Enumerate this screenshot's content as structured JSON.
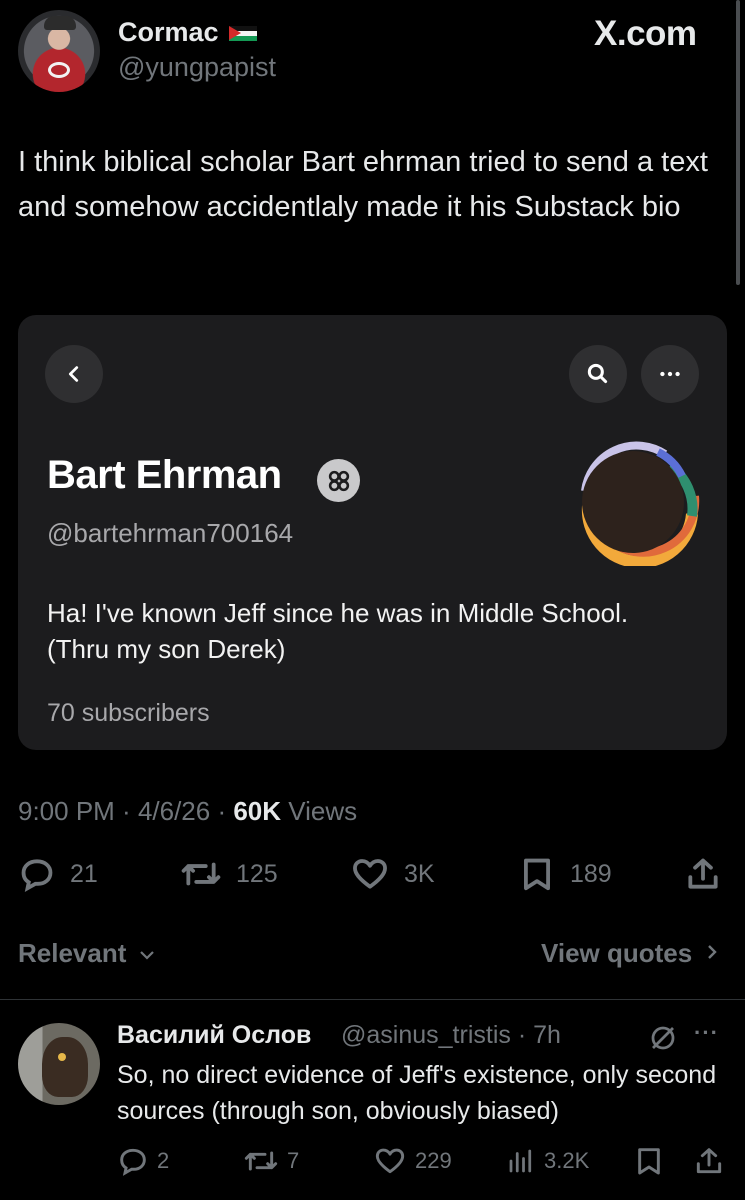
{
  "header": {
    "author_name": "Cormac",
    "author_handle": "@yungpapist",
    "site_label": "X.com"
  },
  "tweet": {
    "text": "I think biblical scholar Bart ehrman tried to send a text and somehow accidentlaly made it his Substack bio"
  },
  "embedded_profile": {
    "name": "Bart Ehrman",
    "handle": "@bartehrman700164",
    "bio": "Ha! I've known Jeff since he was in Middle School. (Thru my son Derek)",
    "subscribers": "70 subscribers",
    "back_icon": "chevron-left-icon",
    "search_icon": "search-icon",
    "more_icon": "more-horizontal-icon"
  },
  "meta": {
    "time": "9:00 PM",
    "separator": " · ",
    "date": "4/6/26",
    "views_count": "60K",
    "views_label": " Views"
  },
  "actions": {
    "replies": "21",
    "reposts": "125",
    "likes": "3K",
    "bookmarks": "189"
  },
  "sort": {
    "relevant_label": "Relevant",
    "view_quotes_label": "View quotes"
  },
  "reply": {
    "name": "Василий Ослов",
    "handle_time": "@asinus_tristis · 7h",
    "text": "So, no direct evidence of Jeff's existence, only second sources (through son, obviously biased)",
    "replies": "2",
    "reposts": "7",
    "likes": "229",
    "views": "3.2K",
    "more": "···"
  },
  "colors": {
    "background": "#000000",
    "text_primary": "#e7e9ea",
    "text_secondary": "#71767b",
    "card_background": "#1c1c1e"
  }
}
